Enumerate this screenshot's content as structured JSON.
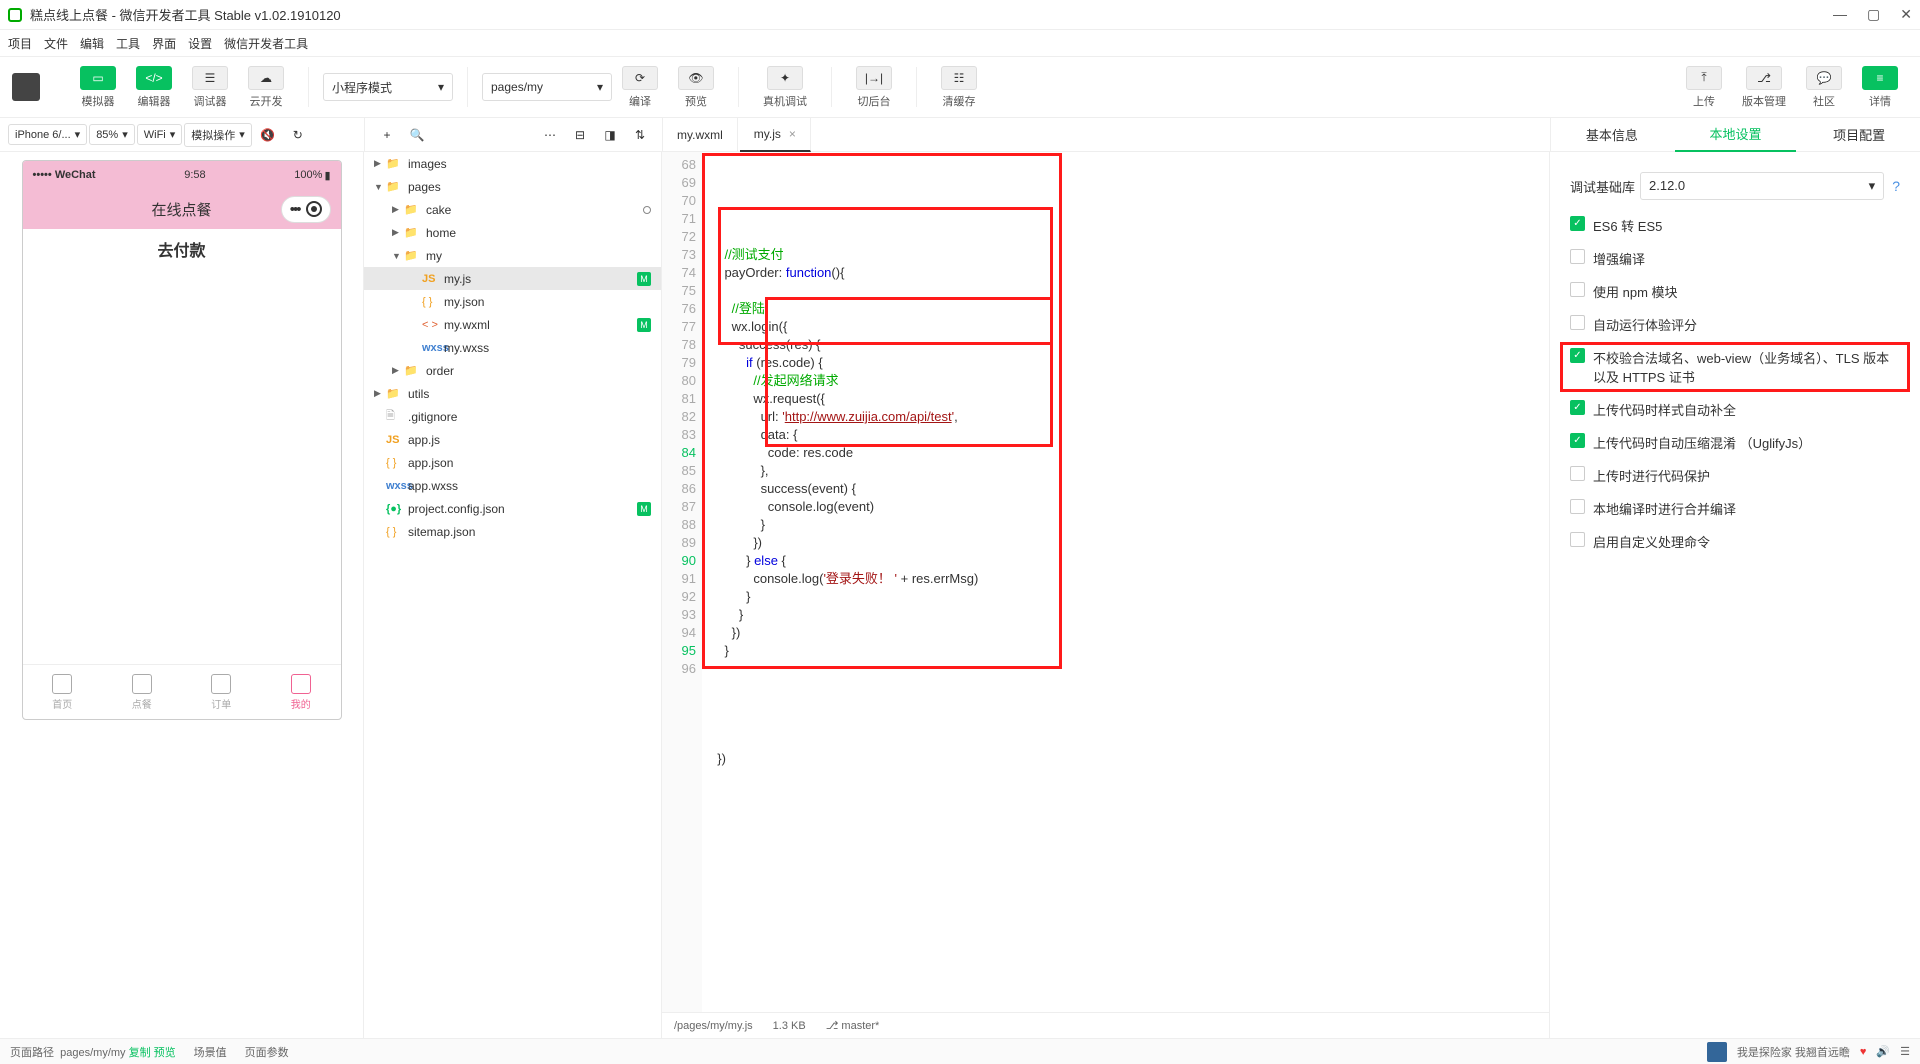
{
  "window": {
    "title": "糕点线上点餐 - 微信开发者工具 Stable v1.02.1910120"
  },
  "menus": [
    "项目",
    "文件",
    "编辑",
    "工具",
    "界面",
    "设置",
    "微信开发者工具"
  ],
  "toolbar": {
    "simulator": "模拟器",
    "editor": "编辑器",
    "debugger": "调试器",
    "cloud": "云开发",
    "mode_select": "小程序模式",
    "page_select": "pages/my",
    "compile": "编译",
    "preview": "预览",
    "realdebug": "真机调试",
    "background": "切后台",
    "clearcache": "清缓存",
    "upload": "上传",
    "version": "版本管理",
    "community": "社区",
    "more": "详情"
  },
  "subbar": {
    "device": "iPhone 6/...",
    "zoom": "85%",
    "network": "WiFi",
    "simop": "模拟操作"
  },
  "phone": {
    "carrier": "WeChat",
    "time": "9:58",
    "battery": "100%",
    "navtitle": "在线点餐",
    "pay_button": "去付款",
    "tabs": [
      "首页",
      "点餐",
      "订单",
      "我的"
    ]
  },
  "tree": [
    {
      "d": 0,
      "arr": "▶",
      "ic": "folder",
      "name": "images"
    },
    {
      "d": 0,
      "arr": "▼",
      "ic": "folder",
      "name": "pages"
    },
    {
      "d": 1,
      "arr": "▶",
      "ic": "folder",
      "name": "cake",
      "dot": true
    },
    {
      "d": 1,
      "arr": "▶",
      "ic": "folder",
      "name": "home"
    },
    {
      "d": 1,
      "arr": "▼",
      "ic": "folder",
      "name": "my"
    },
    {
      "d": 2,
      "arr": "",
      "ic": "js",
      "ict": "JS",
      "name": "my.js",
      "badge": "M",
      "sel": true
    },
    {
      "d": 2,
      "arr": "",
      "ic": "json",
      "ict": "{ }",
      "name": "my.json"
    },
    {
      "d": 2,
      "arr": "",
      "ic": "wxml",
      "ict": "< >",
      "name": "my.wxml",
      "badge": "M"
    },
    {
      "d": 2,
      "arr": "",
      "ic": "wxss",
      "ict": "wxss",
      "name": "my.wxss"
    },
    {
      "d": 1,
      "arr": "▶",
      "ic": "folder",
      "name": "order"
    },
    {
      "d": 0,
      "arr": "▶",
      "ic": "folder",
      "name": "utils"
    },
    {
      "d": 0,
      "arr": "",
      "ic": "file",
      "ict": "🗎",
      "name": ".gitignore"
    },
    {
      "d": 0,
      "arr": "",
      "ic": "js",
      "ict": "JS",
      "name": "app.js"
    },
    {
      "d": 0,
      "arr": "",
      "ic": "json",
      "ict": "{ }",
      "name": "app.json"
    },
    {
      "d": 0,
      "arr": "",
      "ic": "wxss",
      "ict": "wxss",
      "name": "app.wxss"
    },
    {
      "d": 0,
      "arr": "",
      "ic": "cfg",
      "ict": "{●}",
      "name": "project.config.json",
      "badge": "M"
    },
    {
      "d": 0,
      "arr": "",
      "ic": "json",
      "ict": "{ }",
      "name": "sitemap.json"
    }
  ],
  "editor_tabs": [
    {
      "name": "my.wxml",
      "active": false
    },
    {
      "name": "my.js",
      "active": true
    }
  ],
  "code_start": 68,
  "code_lines": [
    "    <span class='cm'>//测试支付</span>",
    "    payOrder: <span class='fn'>function</span>(){",
    "",
    "      <span class='cm'>//登陆</span>",
    "      wx.login({",
    "        success(res) {",
    "          <span class='kw'>if</span> (res.code) {",
    "            <span class='cm'>//发起网络请求</span>",
    "            wx.request({",
    "              url: <span class='str'>'</span><span class='url'>http://www.zuijia.com/api/test</span><span class='str'>'</span>,",
    "              data: {",
    "                code: res.code",
    "              },",
    "              success(event) {",
    "                console.log(event)",
    "              }",
    "            })",
    "          } <span class='kw'>else</span> {",
    "            console.log(<span class='str'>'登录失败！ '</span> + res.errMsg)",
    "          }",
    "        }",
    "      })",
    "    }",
    "",
    "",
    "",
    "",
    "",
    "  })"
  ],
  "statusbar": {
    "path": "/pages/my/my.js",
    "size": "1.3 KB",
    "branch": "master*"
  },
  "right_tabs": [
    "基本信息",
    "本地设置",
    "项目配置"
  ],
  "right_settings": {
    "debug_lib_label": "调试基础库",
    "debug_lib_value": "2.12.0",
    "checks": [
      {
        "on": true,
        "label": "ES6 转 ES5"
      },
      {
        "on": false,
        "label": "增强编译"
      },
      {
        "on": false,
        "label": "使用 npm 模块"
      },
      {
        "on": false,
        "label": "自动运行体验评分"
      },
      {
        "on": true,
        "label": "不校验合法域名、web-view（业务域名）、TLS 版本以及 HTTPS 证书",
        "hl": true
      },
      {
        "on": true,
        "label": "上传代码时样式自动补全"
      },
      {
        "on": true,
        "label": "上传代码时自动压缩混淆  （UglifyJs）"
      },
      {
        "on": false,
        "label": "上传时进行代码保护"
      },
      {
        "on": false,
        "label": "本地编译时进行合并编译"
      },
      {
        "on": false,
        "label": "启用自定义处理命令"
      }
    ]
  },
  "footer": {
    "path_label": "页面路径",
    "path_value": "pages/my/my",
    "copy": "复制",
    "preview": "预览",
    "scene": "场景值",
    "params": "页面参数",
    "music": "我是探险家 我翘首远瞻"
  }
}
